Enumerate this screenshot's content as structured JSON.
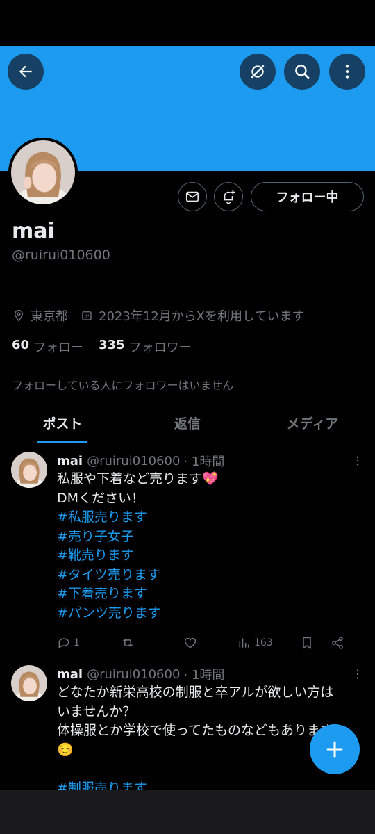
{
  "colors": {
    "accent": "#1d9bf0",
    "background": "#000000",
    "muted": "#71767b",
    "text": "#e7e9ea"
  },
  "header": {
    "back_icon": "arrow-left-icon",
    "grok_icon": "grok-icon",
    "search_icon": "search-icon",
    "more_icon": "more-vertical-icon"
  },
  "profile": {
    "display_name": "mai",
    "handle": "@ruirui010600",
    "location": "東京都",
    "joined": "2023年12月からXを利用しています",
    "following_count": "60",
    "following_label": "フォロー",
    "followers_count": "335",
    "followers_label": "フォロワー",
    "followers_you_know": "フォローしている人にフォロワーはいません",
    "follow_button": "フォロー中",
    "message_icon": "mail-icon",
    "notify_icon": "bell-plus-icon"
  },
  "tabs": [
    {
      "label": "ポスト",
      "active": true
    },
    {
      "label": "返信",
      "active": false
    },
    {
      "label": "メディア",
      "active": false
    }
  ],
  "tweets": [
    {
      "name": "mai",
      "handle": "@ruirui010600",
      "time": "· 1時間",
      "lines": [
        {
          "text": "私服や下着など売ります💖",
          "hashtag": false
        },
        {
          "text": "DMください！",
          "hashtag": false
        },
        {
          "text": "#私服売ります",
          "hashtag": true
        },
        {
          "text": "#売り子女子",
          "hashtag": true
        },
        {
          "text": "#靴売ります",
          "hashtag": true
        },
        {
          "text": "#タイツ売ります",
          "hashtag": true
        },
        {
          "text": "#下着売ります",
          "hashtag": true
        },
        {
          "text": "#パンツ売ります",
          "hashtag": true
        }
      ],
      "replies": "1",
      "retweets": "",
      "likes": "",
      "views": "163"
    },
    {
      "name": "mai",
      "handle": "@ruirui010600",
      "time": "· 1時間",
      "lines": [
        {
          "text": "どなたか新栄高校の制服と卒アルが欲しい方は",
          "hashtag": false
        },
        {
          "text": "いませんか？",
          "hashtag": false
        },
        {
          "text": "体操服とか学校で使ってたものなどもあります",
          "hashtag": false
        },
        {
          "text": "☺️",
          "hashtag": false
        },
        {
          "text": "",
          "hashtag": false
        },
        {
          "text": "#制服売ります",
          "hashtag": true
        }
      ]
    }
  ],
  "fab_icon": "plus-icon"
}
